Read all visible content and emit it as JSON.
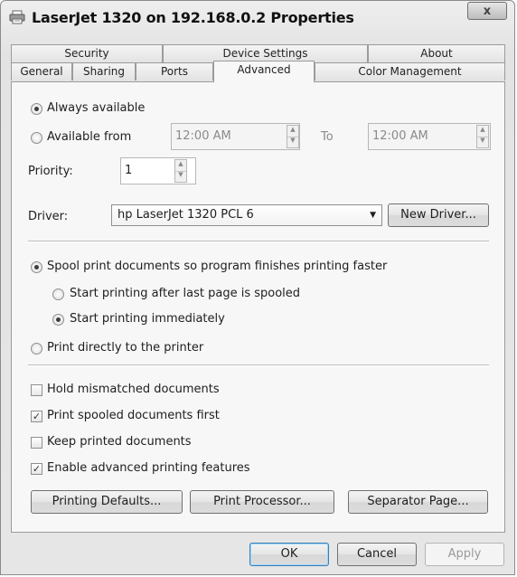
{
  "window": {
    "title": "LaserJet 1320 on 192.168.0.2 Properties",
    "close_label": "x"
  },
  "tabs": {
    "row1": [
      "Security",
      "Device Settings",
      "About"
    ],
    "row2": [
      "General",
      "Sharing",
      "Ports",
      "Advanced",
      "Color Management"
    ],
    "active": "Advanced"
  },
  "availability": {
    "always_label": "Always available",
    "from_label": "Available from",
    "from_time": "12:00 AM",
    "to_label": "To",
    "to_time": "12:00 AM",
    "selected": "always"
  },
  "priority": {
    "label": "Priority:",
    "value": "1"
  },
  "driver": {
    "label": "Driver:",
    "value": "hp LaserJet 1320 PCL 6",
    "new_driver_label": "New Driver..."
  },
  "spooling": {
    "spool_label": "Spool print documents so program finishes printing faster",
    "after_last_label": "Start printing after last page is spooled",
    "immediately_label": "Start printing immediately",
    "direct_label": "Print directly to the printer",
    "selected_mode": "spool",
    "selected_start": "immediately"
  },
  "options": {
    "hold_mismatched": {
      "label": "Hold mismatched documents",
      "checked": false
    },
    "spooled_first": {
      "label": "Print spooled documents first",
      "checked": true
    },
    "keep_printed": {
      "label": "Keep printed documents",
      "checked": false
    },
    "advanced_features": {
      "label": "Enable advanced printing features",
      "checked": true
    }
  },
  "panel_buttons": {
    "printing_defaults": "Printing Defaults...",
    "print_processor": "Print Processor...",
    "separator_page": "Separator Page..."
  },
  "footer": {
    "ok": "OK",
    "cancel": "Cancel",
    "apply": "Apply"
  },
  "colors": {
    "check_mark": "✓"
  }
}
